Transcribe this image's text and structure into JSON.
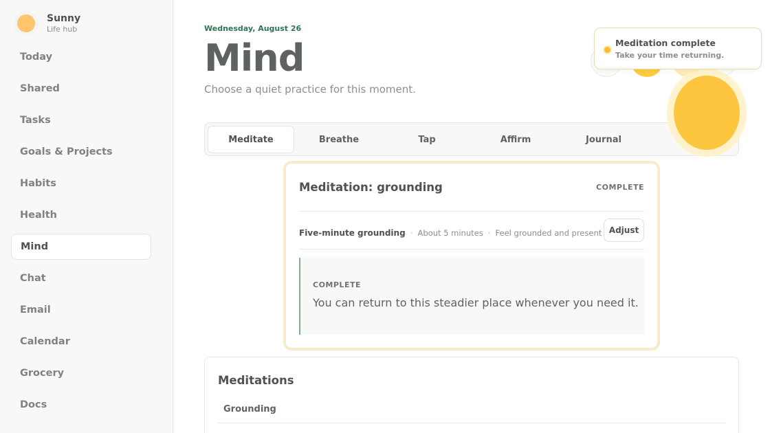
{
  "brand": {
    "name": "Sunny",
    "subtitle": "Life hub",
    "avatar_icon": "sun-avatar-icon"
  },
  "sidebar": {
    "items": [
      {
        "label": "Today",
        "active": false
      },
      {
        "label": "Shared",
        "active": false
      },
      {
        "label": "Tasks",
        "active": false
      },
      {
        "label": "Goals & Projects",
        "active": false
      },
      {
        "label": "Habits",
        "active": false
      },
      {
        "label": "Health",
        "active": false
      },
      {
        "label": "Mind",
        "active": true
      },
      {
        "label": "Chat",
        "active": false
      },
      {
        "label": "Email",
        "active": false
      },
      {
        "label": "Calendar",
        "active": false
      },
      {
        "label": "Grocery",
        "active": false
      },
      {
        "label": "Docs",
        "active": false
      }
    ]
  },
  "header": {
    "date": "Wednesday, August 26",
    "title": "Mind",
    "subtitle": "Choose a quiet practice for this moment."
  },
  "tabs": [
    {
      "label": "Meditate",
      "active": true
    },
    {
      "label": "Breathe",
      "active": false
    },
    {
      "label": "Tap",
      "active": false
    },
    {
      "label": "Affirm",
      "active": false
    },
    {
      "label": "Journal",
      "active": false
    }
  ],
  "session": {
    "title": "Meditation: grounding",
    "status": "COMPLETE",
    "name": "Five-minute grounding",
    "duration": "About 5 minutes",
    "intent": "Feel grounded and present",
    "adjust_label": "Adjust",
    "callout_label": "COMPLETE",
    "callout_text": "You can return to this steadier place whenever you need it."
  },
  "meditations": {
    "title": "Meditations",
    "rows": [
      "Grounding"
    ]
  },
  "toast": {
    "title": "Meditation complete",
    "subtitle": "Take your time returning."
  },
  "colors": {
    "accent_green": "#2f7450",
    "sun_yellow": "#fec53f",
    "card_border": "#f6ebcc",
    "callout_border": "#7fae8d"
  }
}
